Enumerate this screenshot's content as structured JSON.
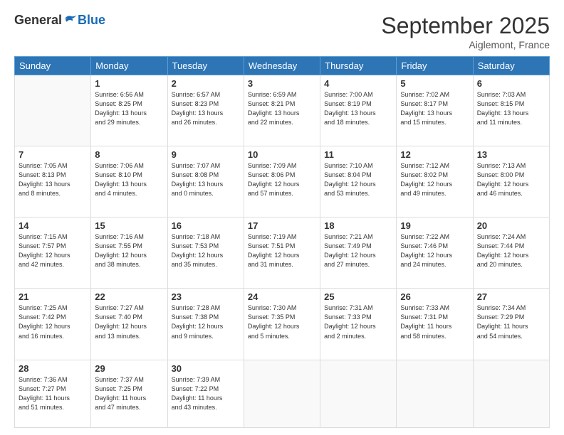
{
  "header": {
    "logo_general": "General",
    "logo_blue": "Blue",
    "month_title": "September 2025",
    "location": "Aiglemont, France"
  },
  "days_of_week": [
    "Sunday",
    "Monday",
    "Tuesday",
    "Wednesday",
    "Thursday",
    "Friday",
    "Saturday"
  ],
  "weeks": [
    [
      {
        "day": "",
        "info": ""
      },
      {
        "day": "1",
        "info": "Sunrise: 6:56 AM\nSunset: 8:25 PM\nDaylight: 13 hours\nand 29 minutes."
      },
      {
        "day": "2",
        "info": "Sunrise: 6:57 AM\nSunset: 8:23 PM\nDaylight: 13 hours\nand 26 minutes."
      },
      {
        "day": "3",
        "info": "Sunrise: 6:59 AM\nSunset: 8:21 PM\nDaylight: 13 hours\nand 22 minutes."
      },
      {
        "day": "4",
        "info": "Sunrise: 7:00 AM\nSunset: 8:19 PM\nDaylight: 13 hours\nand 18 minutes."
      },
      {
        "day": "5",
        "info": "Sunrise: 7:02 AM\nSunset: 8:17 PM\nDaylight: 13 hours\nand 15 minutes."
      },
      {
        "day": "6",
        "info": "Sunrise: 7:03 AM\nSunset: 8:15 PM\nDaylight: 13 hours\nand 11 minutes."
      }
    ],
    [
      {
        "day": "7",
        "info": "Sunrise: 7:05 AM\nSunset: 8:13 PM\nDaylight: 13 hours\nand 8 minutes."
      },
      {
        "day": "8",
        "info": "Sunrise: 7:06 AM\nSunset: 8:10 PM\nDaylight: 13 hours\nand 4 minutes."
      },
      {
        "day": "9",
        "info": "Sunrise: 7:07 AM\nSunset: 8:08 PM\nDaylight: 13 hours\nand 0 minutes."
      },
      {
        "day": "10",
        "info": "Sunrise: 7:09 AM\nSunset: 8:06 PM\nDaylight: 12 hours\nand 57 minutes."
      },
      {
        "day": "11",
        "info": "Sunrise: 7:10 AM\nSunset: 8:04 PM\nDaylight: 12 hours\nand 53 minutes."
      },
      {
        "day": "12",
        "info": "Sunrise: 7:12 AM\nSunset: 8:02 PM\nDaylight: 12 hours\nand 49 minutes."
      },
      {
        "day": "13",
        "info": "Sunrise: 7:13 AM\nSunset: 8:00 PM\nDaylight: 12 hours\nand 46 minutes."
      }
    ],
    [
      {
        "day": "14",
        "info": "Sunrise: 7:15 AM\nSunset: 7:57 PM\nDaylight: 12 hours\nand 42 minutes."
      },
      {
        "day": "15",
        "info": "Sunrise: 7:16 AM\nSunset: 7:55 PM\nDaylight: 12 hours\nand 38 minutes."
      },
      {
        "day": "16",
        "info": "Sunrise: 7:18 AM\nSunset: 7:53 PM\nDaylight: 12 hours\nand 35 minutes."
      },
      {
        "day": "17",
        "info": "Sunrise: 7:19 AM\nSunset: 7:51 PM\nDaylight: 12 hours\nand 31 minutes."
      },
      {
        "day": "18",
        "info": "Sunrise: 7:21 AM\nSunset: 7:49 PM\nDaylight: 12 hours\nand 27 minutes."
      },
      {
        "day": "19",
        "info": "Sunrise: 7:22 AM\nSunset: 7:46 PM\nDaylight: 12 hours\nand 24 minutes."
      },
      {
        "day": "20",
        "info": "Sunrise: 7:24 AM\nSunset: 7:44 PM\nDaylight: 12 hours\nand 20 minutes."
      }
    ],
    [
      {
        "day": "21",
        "info": "Sunrise: 7:25 AM\nSunset: 7:42 PM\nDaylight: 12 hours\nand 16 minutes."
      },
      {
        "day": "22",
        "info": "Sunrise: 7:27 AM\nSunset: 7:40 PM\nDaylight: 12 hours\nand 13 minutes."
      },
      {
        "day": "23",
        "info": "Sunrise: 7:28 AM\nSunset: 7:38 PM\nDaylight: 12 hours\nand 9 minutes."
      },
      {
        "day": "24",
        "info": "Sunrise: 7:30 AM\nSunset: 7:35 PM\nDaylight: 12 hours\nand 5 minutes."
      },
      {
        "day": "25",
        "info": "Sunrise: 7:31 AM\nSunset: 7:33 PM\nDaylight: 12 hours\nand 2 minutes."
      },
      {
        "day": "26",
        "info": "Sunrise: 7:33 AM\nSunset: 7:31 PM\nDaylight: 11 hours\nand 58 minutes."
      },
      {
        "day": "27",
        "info": "Sunrise: 7:34 AM\nSunset: 7:29 PM\nDaylight: 11 hours\nand 54 minutes."
      }
    ],
    [
      {
        "day": "28",
        "info": "Sunrise: 7:36 AM\nSunset: 7:27 PM\nDaylight: 11 hours\nand 51 minutes."
      },
      {
        "day": "29",
        "info": "Sunrise: 7:37 AM\nSunset: 7:25 PM\nDaylight: 11 hours\nand 47 minutes."
      },
      {
        "day": "30",
        "info": "Sunrise: 7:39 AM\nSunset: 7:22 PM\nDaylight: 11 hours\nand 43 minutes."
      },
      {
        "day": "",
        "info": ""
      },
      {
        "day": "",
        "info": ""
      },
      {
        "day": "",
        "info": ""
      },
      {
        "day": "",
        "info": ""
      }
    ]
  ]
}
